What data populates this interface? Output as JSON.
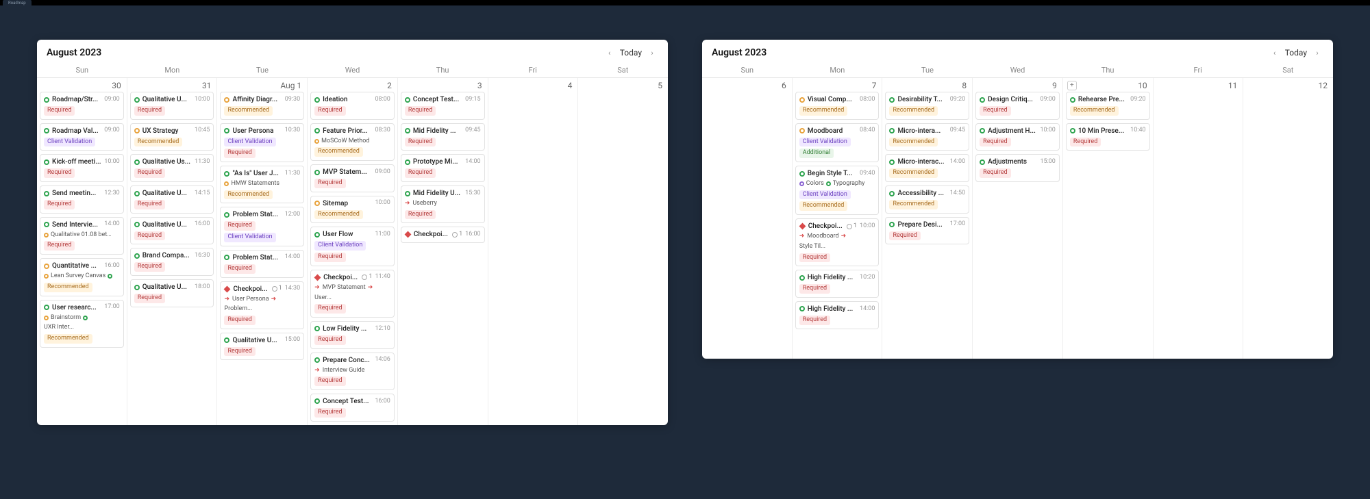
{
  "top_tab": "Roadmap",
  "panels": {
    "left": {
      "title": "August 2023",
      "today_label": "Today",
      "dow": [
        "Sun",
        "Mon",
        "Tue",
        "Wed",
        "Thu",
        "Fri",
        "Sat"
      ],
      "days": [
        {
          "num": "30",
          "events": [
            {
              "dot": "green",
              "title": "Roadmap/Str...",
              "time": "09:00",
              "tags": [
                "Required"
              ]
            },
            {
              "dot": "green",
              "title": "Roadmap Val...",
              "time": "09:00",
              "tags": [
                "Client Validation"
              ]
            },
            {
              "dot": "green",
              "title": "Kick-off meeti...",
              "time": "10:00",
              "tags": [
                "Required"
              ]
            },
            {
              "dot": "green",
              "title": "Send meetin...",
              "time": "12:30",
              "tags": [
                "Required"
              ]
            },
            {
              "dot": "green",
              "title": "Send Intervie...",
              "time": "14:00",
              "subs": [
                {
                  "icon": "orange",
                  "txt": "Qualitative 01.08 between..."
                }
              ],
              "tags": [
                "Required"
              ]
            },
            {
              "dot": "orange",
              "title": "Quantitative ...",
              "time": "16:00",
              "subs": [
                {
                  "icon": "orange",
                  "txt": "Lean Survey Canvas"
                },
                {
                  "icon": "green",
                  "txt": ""
                }
              ],
              "tags": [
                "Recommended"
              ]
            },
            {
              "dot": "green",
              "title": "User researc...",
              "time": "17:00",
              "subs": [
                {
                  "icon": "orange",
                  "txt": "Brainstorm"
                },
                {
                  "icon": "green",
                  "txt": "UXR Inter..."
                }
              ],
              "tags": [
                "Recommended"
              ]
            }
          ]
        },
        {
          "num": "31",
          "events": [
            {
              "dot": "green",
              "title": "Qualitative U...",
              "time": "10:00",
              "tags": [
                "Required"
              ]
            },
            {
              "dot": "orange",
              "title": "UX Strategy",
              "time": "10:45",
              "tags": [
                "Recommended"
              ]
            },
            {
              "dot": "green",
              "title": "Qualitative Us...",
              "time": "11:30",
              "tags": [
                "Required"
              ]
            },
            {
              "dot": "green",
              "title": "Qualitative U...",
              "time": "14:15",
              "tags": [
                "Required"
              ]
            },
            {
              "dot": "green",
              "title": "Qualitative U...",
              "time": "16:00",
              "tags": [
                "Required"
              ]
            },
            {
              "dot": "green",
              "title": "Brand Compa...",
              "time": "16:30",
              "tags": [
                "Required"
              ]
            },
            {
              "dot": "green",
              "title": "Qualitative U...",
              "time": "18:00",
              "tags": [
                "Required"
              ]
            }
          ]
        },
        {
          "num": "Aug 1",
          "events": [
            {
              "dot": "orange",
              "title": "Affinity Diagr...",
              "time": "09:30",
              "tags": [
                "Recommended"
              ]
            },
            {
              "dot": "green",
              "title": "User Persona",
              "time": "10:30",
              "tags": [
                "Client Validation",
                "Required"
              ]
            },
            {
              "dot": "green",
              "title": "\"As Is\" User J...",
              "time": "11:30",
              "subs": [
                {
                  "icon": "orange",
                  "txt": "HMW Statements"
                }
              ],
              "tags": [
                "Recommended"
              ]
            },
            {
              "dot": "green",
              "title": "Problem Stat...",
              "time": "12:00",
              "tags": [
                "Required",
                "Client Validation"
              ]
            },
            {
              "dot": "green",
              "title": "Problem Stat...",
              "time": "14:00",
              "tags": [
                "Required"
              ]
            },
            {
              "diamond": true,
              "title": "Checkpoi...",
              "count": "1",
              "time": "14:30",
              "subs": [
                {
                  "arrow": true,
                  "txt": "User Persona"
                },
                {
                  "arrow": true,
                  "txt": "Problem..."
                }
              ],
              "tags": [
                "Required"
              ]
            },
            {
              "dot": "green",
              "title": "Qualitative U...",
              "time": "15:00",
              "tags": [
                "Required"
              ]
            }
          ]
        },
        {
          "num": "2",
          "events": [
            {
              "dot": "green",
              "title": "Ideation",
              "time": "08:00",
              "tags": [
                "Required"
              ]
            },
            {
              "dot": "green",
              "title": "Feature Prior...",
              "time": "08:30",
              "subs": [
                {
                  "icon": "orange",
                  "txt": "MoSCoW Method"
                }
              ],
              "tags": [
                "Recommended"
              ]
            },
            {
              "dot": "green",
              "title": "MVP Statem...",
              "time": "09:00",
              "tags": [
                "Required"
              ]
            },
            {
              "dot": "orange",
              "title": "Sitemap",
              "time": "10:00",
              "tags": [
                "Recommended"
              ]
            },
            {
              "dot": "green",
              "title": "User Flow",
              "time": "11:00",
              "tags": [
                "Client Validation",
                "Required"
              ]
            },
            {
              "diamond": true,
              "title": "Checkpoi...",
              "count": "1",
              "time": "11:40",
              "subs": [
                {
                  "arrow": true,
                  "txt": "MVP Statement"
                },
                {
                  "arrow": true,
                  "txt": "User..."
                }
              ],
              "tags": [
                "Required"
              ]
            },
            {
              "dot": "green",
              "title": "Low Fidelity ...",
              "time": "12:10",
              "tags": [
                "Required"
              ]
            },
            {
              "dot": "green",
              "title": "Prepare Conc...",
              "time": "14:06",
              "subs": [
                {
                  "arrow": true,
                  "txt": "Interview Guide"
                }
              ],
              "tags": [
                "Required"
              ]
            },
            {
              "dot": "green",
              "title": "Concept Test...",
              "time": "16:00",
              "tags": [
                "Required"
              ]
            }
          ]
        },
        {
          "num": "3",
          "events": [
            {
              "dot": "green",
              "title": "Concept Test...",
              "time": "09:15",
              "tags": [
                "Required"
              ]
            },
            {
              "dot": "green",
              "title": "Mid Fidelity ...",
              "time": "09:45",
              "tags": [
                "Required"
              ]
            },
            {
              "dot": "green",
              "title": "Prototype Mi...",
              "time": "14:00",
              "tags": [
                "Required"
              ]
            },
            {
              "dot": "green",
              "title": "Mid Fidelity U...",
              "time": "15:30",
              "subs": [
                {
                  "arrow": true,
                  "txt": "Useberry"
                }
              ],
              "tags": [
                "Required"
              ]
            },
            {
              "diamond": true,
              "title": "Checkpoi...",
              "count": "1",
              "time": "16:00"
            }
          ]
        },
        {
          "num": "4",
          "events": []
        },
        {
          "num": "5",
          "events": []
        }
      ]
    },
    "right": {
      "title": "August 2023",
      "today_label": "Today",
      "dow": [
        "Sun",
        "Mon",
        "Tue",
        "Wed",
        "Thu",
        "Fri",
        "Sat"
      ],
      "days": [
        {
          "num": "6",
          "events": []
        },
        {
          "num": "7",
          "events": [
            {
              "dot": "orange",
              "title": "Visual Comp...",
              "time": "08:00",
              "tags": [
                "Recommended"
              ]
            },
            {
              "dot": "orange",
              "title": "Moodboard",
              "time": "08:40",
              "tags": [
                "Client Validation",
                "Additional"
              ]
            },
            {
              "dot": "green",
              "title": "Begin Style T...",
              "time": "09:40",
              "subs": [
                {
                  "icon": "purple",
                  "txt": "Colors"
                },
                {
                  "icon": "green",
                  "txt": "Typography"
                }
              ],
              "tags": [
                "Client Validation",
                "Recommended"
              ]
            },
            {
              "diamond": true,
              "title": "Checkpoi...",
              "count": "1",
              "time": "10:00",
              "subs": [
                {
                  "arrow": true,
                  "txt": "Moodboard"
                },
                {
                  "arrow": true,
                  "txt": "Style Til..."
                }
              ],
              "tags": [
                "Required"
              ]
            },
            {
              "dot": "green",
              "title": "High Fidelity ...",
              "time": "10:20",
              "tags": [
                "Required"
              ]
            },
            {
              "dot": "green",
              "title": "High Fidelity ...",
              "time": "14:00",
              "tags": [
                "Required"
              ]
            }
          ]
        },
        {
          "num": "8",
          "events": [
            {
              "dot": "green",
              "title": "Desirability T...",
              "time": "09:20",
              "tags": [
                "Recommended"
              ]
            },
            {
              "dot": "green",
              "title": "Micro-intera...",
              "time": "09:45",
              "tags": [
                "Recommended"
              ]
            },
            {
              "dot": "green",
              "title": "Micro-interac...",
              "time": "14:00",
              "tags": [
                "Recommended"
              ]
            },
            {
              "dot": "green",
              "title": "Accessibility ...",
              "time": "14:50",
              "tags": [
                "Recommended"
              ]
            },
            {
              "dot": "green",
              "title": "Prepare Desi...",
              "time": "17:00",
              "tags": [
                "Required"
              ]
            }
          ]
        },
        {
          "num": "9",
          "events": [
            {
              "dot": "green",
              "title": "Design Critiq...",
              "time": "09:00",
              "tags": [
                "Required"
              ]
            },
            {
              "dot": "green",
              "title": "Adjustment H...",
              "time": "10:00",
              "tags": [
                "Required"
              ]
            },
            {
              "dot": "green",
              "title": "Adjustments",
              "time": "15:00",
              "tags": [
                "Required"
              ]
            }
          ]
        },
        {
          "num": "10",
          "add": true,
          "events": [
            {
              "dot": "green",
              "title": "Rehearse Pre...",
              "time": "09:20",
              "tags": [
                "Recommended"
              ]
            },
            {
              "dot": "green",
              "title": "10 Min Prese...",
              "time": "10:40",
              "tags": [
                "Required"
              ]
            }
          ]
        },
        {
          "num": "11",
          "events": []
        },
        {
          "num": "12",
          "events": []
        }
      ]
    }
  }
}
